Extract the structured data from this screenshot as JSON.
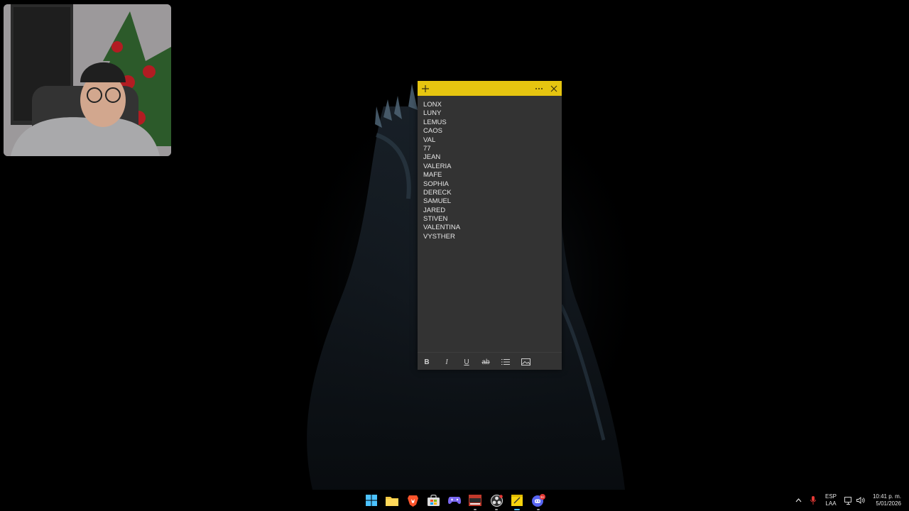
{
  "sticky_note": {
    "lines": [
      "LONX",
      "LUNY",
      "LEMUS",
      "CAOS",
      "VAL",
      "77",
      "JEAN",
      "VALERIA",
      "MAFE",
      "SOPHIA",
      "DERECK",
      "SAMUEL",
      "JARED",
      "STIVEN",
      "VALENTINA",
      "VYSTHER"
    ],
    "header_color": "#e6c510",
    "background_color": "#333333",
    "header_buttons": {
      "add_icon": "plus-icon",
      "more_icon": "more-icon",
      "close_icon": "close-icon"
    },
    "toolbar": {
      "bold": "B",
      "italic": "I",
      "underline": "U",
      "strikethrough": "ab",
      "bullets_icon": "bullet-list-icon",
      "image_icon": "image-icon"
    }
  },
  "taskbar": {
    "apps": [
      {
        "name": "Start",
        "icon": "windows-icon"
      },
      {
        "name": "File Explorer",
        "icon": "folder-icon"
      },
      {
        "name": "Brave",
        "icon": "brave-icon"
      },
      {
        "name": "Microsoft Store",
        "icon": "store-icon"
      },
      {
        "name": "Game Bar",
        "icon": "gamepad-icon"
      },
      {
        "name": "Media Player",
        "icon": "media-app-icon"
      },
      {
        "name": "OBS",
        "icon": "obs-icon"
      },
      {
        "name": "Sticky Notes",
        "icon": "sticky-notes-icon"
      },
      {
        "name": "Discord",
        "icon": "discord-icon",
        "badge": "9+"
      }
    ],
    "tray": {
      "language": "ESP",
      "layout": "LAA",
      "time": "10:41 p. m.",
      "date": "5/01/2026"
    }
  }
}
